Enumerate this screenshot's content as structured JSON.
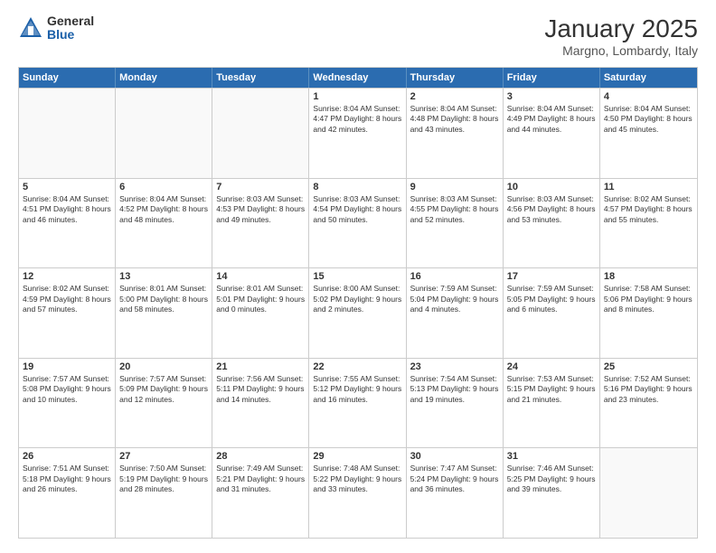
{
  "header": {
    "logo": {
      "general": "General",
      "blue": "Blue"
    },
    "title": "January 2025",
    "location": "Margno, Lombardy, Italy"
  },
  "days_of_week": [
    "Sunday",
    "Monday",
    "Tuesday",
    "Wednesday",
    "Thursday",
    "Friday",
    "Saturday"
  ],
  "weeks": [
    [
      {
        "day": "",
        "info": ""
      },
      {
        "day": "",
        "info": ""
      },
      {
        "day": "",
        "info": ""
      },
      {
        "day": "1",
        "info": "Sunrise: 8:04 AM\nSunset: 4:47 PM\nDaylight: 8 hours\nand 42 minutes."
      },
      {
        "day": "2",
        "info": "Sunrise: 8:04 AM\nSunset: 4:48 PM\nDaylight: 8 hours\nand 43 minutes."
      },
      {
        "day": "3",
        "info": "Sunrise: 8:04 AM\nSunset: 4:49 PM\nDaylight: 8 hours\nand 44 minutes."
      },
      {
        "day": "4",
        "info": "Sunrise: 8:04 AM\nSunset: 4:50 PM\nDaylight: 8 hours\nand 45 minutes."
      }
    ],
    [
      {
        "day": "5",
        "info": "Sunrise: 8:04 AM\nSunset: 4:51 PM\nDaylight: 8 hours\nand 46 minutes."
      },
      {
        "day": "6",
        "info": "Sunrise: 8:04 AM\nSunset: 4:52 PM\nDaylight: 8 hours\nand 48 minutes."
      },
      {
        "day": "7",
        "info": "Sunrise: 8:03 AM\nSunset: 4:53 PM\nDaylight: 8 hours\nand 49 minutes."
      },
      {
        "day": "8",
        "info": "Sunrise: 8:03 AM\nSunset: 4:54 PM\nDaylight: 8 hours\nand 50 minutes."
      },
      {
        "day": "9",
        "info": "Sunrise: 8:03 AM\nSunset: 4:55 PM\nDaylight: 8 hours\nand 52 minutes."
      },
      {
        "day": "10",
        "info": "Sunrise: 8:03 AM\nSunset: 4:56 PM\nDaylight: 8 hours\nand 53 minutes."
      },
      {
        "day": "11",
        "info": "Sunrise: 8:02 AM\nSunset: 4:57 PM\nDaylight: 8 hours\nand 55 minutes."
      }
    ],
    [
      {
        "day": "12",
        "info": "Sunrise: 8:02 AM\nSunset: 4:59 PM\nDaylight: 8 hours\nand 57 minutes."
      },
      {
        "day": "13",
        "info": "Sunrise: 8:01 AM\nSunset: 5:00 PM\nDaylight: 8 hours\nand 58 minutes."
      },
      {
        "day": "14",
        "info": "Sunrise: 8:01 AM\nSunset: 5:01 PM\nDaylight: 9 hours\nand 0 minutes."
      },
      {
        "day": "15",
        "info": "Sunrise: 8:00 AM\nSunset: 5:02 PM\nDaylight: 9 hours\nand 2 minutes."
      },
      {
        "day": "16",
        "info": "Sunrise: 7:59 AM\nSunset: 5:04 PM\nDaylight: 9 hours\nand 4 minutes."
      },
      {
        "day": "17",
        "info": "Sunrise: 7:59 AM\nSunset: 5:05 PM\nDaylight: 9 hours\nand 6 minutes."
      },
      {
        "day": "18",
        "info": "Sunrise: 7:58 AM\nSunset: 5:06 PM\nDaylight: 9 hours\nand 8 minutes."
      }
    ],
    [
      {
        "day": "19",
        "info": "Sunrise: 7:57 AM\nSunset: 5:08 PM\nDaylight: 9 hours\nand 10 minutes."
      },
      {
        "day": "20",
        "info": "Sunrise: 7:57 AM\nSunset: 5:09 PM\nDaylight: 9 hours\nand 12 minutes."
      },
      {
        "day": "21",
        "info": "Sunrise: 7:56 AM\nSunset: 5:11 PM\nDaylight: 9 hours\nand 14 minutes."
      },
      {
        "day": "22",
        "info": "Sunrise: 7:55 AM\nSunset: 5:12 PM\nDaylight: 9 hours\nand 16 minutes."
      },
      {
        "day": "23",
        "info": "Sunrise: 7:54 AM\nSunset: 5:13 PM\nDaylight: 9 hours\nand 19 minutes."
      },
      {
        "day": "24",
        "info": "Sunrise: 7:53 AM\nSunset: 5:15 PM\nDaylight: 9 hours\nand 21 minutes."
      },
      {
        "day": "25",
        "info": "Sunrise: 7:52 AM\nSunset: 5:16 PM\nDaylight: 9 hours\nand 23 minutes."
      }
    ],
    [
      {
        "day": "26",
        "info": "Sunrise: 7:51 AM\nSunset: 5:18 PM\nDaylight: 9 hours\nand 26 minutes."
      },
      {
        "day": "27",
        "info": "Sunrise: 7:50 AM\nSunset: 5:19 PM\nDaylight: 9 hours\nand 28 minutes."
      },
      {
        "day": "28",
        "info": "Sunrise: 7:49 AM\nSunset: 5:21 PM\nDaylight: 9 hours\nand 31 minutes."
      },
      {
        "day": "29",
        "info": "Sunrise: 7:48 AM\nSunset: 5:22 PM\nDaylight: 9 hours\nand 33 minutes."
      },
      {
        "day": "30",
        "info": "Sunrise: 7:47 AM\nSunset: 5:24 PM\nDaylight: 9 hours\nand 36 minutes."
      },
      {
        "day": "31",
        "info": "Sunrise: 7:46 AM\nSunset: 5:25 PM\nDaylight: 9 hours\nand 39 minutes."
      },
      {
        "day": "",
        "info": ""
      }
    ]
  ]
}
